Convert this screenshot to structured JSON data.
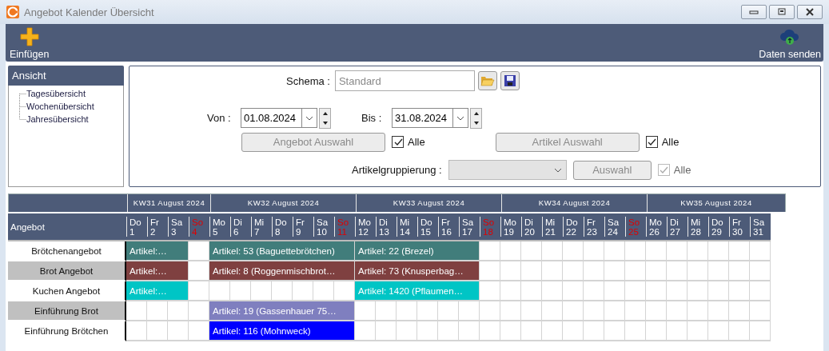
{
  "window": {
    "title": "Angebot Kalender Übersicht"
  },
  "toolbar": {
    "insert_button": "Einfügen",
    "send_button": "Daten senden"
  },
  "view_panel": {
    "title": "Ansicht",
    "items": [
      {
        "label": "Tagesübersicht"
      },
      {
        "label": "Wochenübersicht"
      },
      {
        "label": "Jahresübersicht"
      }
    ]
  },
  "filters": {
    "schema_label": "Schema :",
    "schema": {
      "placeholder": "Standard"
    },
    "from_label": "Von :",
    "from_date": "01.08.2024",
    "to_label": "Bis :",
    "to_date": "31.08.2024",
    "selections": [
      {
        "button": "Angebot Auswahl",
        "button_disabled": true,
        "checkbox_label": "Alle",
        "checked": true,
        "disabled": false
      },
      {
        "button": "Artikel Auswahl",
        "button_disabled": true,
        "checkbox_label": "Alle",
        "checked": true,
        "disabled": false
      }
    ],
    "grouping_label": "Artikelgruppierung :",
    "grouping_disabled": true,
    "grouping_selection": {
      "button": "Auswahl",
      "button_disabled": true,
      "checkbox_label": "Alle",
      "checked": true,
      "disabled": true
    }
  },
  "calendar": {
    "row_header": "Angebot",
    "weeks": [
      {
        "label": "KW31 August 2024",
        "days": [
          {
            "weekday": "Do",
            "day": "1",
            "sunday": false
          },
          {
            "weekday": "Fr",
            "day": "2",
            "sunday": false
          },
          {
            "weekday": "Sa",
            "day": "3",
            "sunday": false
          },
          {
            "weekday": "So",
            "day": "4",
            "sunday": true
          }
        ]
      },
      {
        "label": "KW32 August 2024",
        "days": [
          {
            "weekday": "Mo",
            "day": "5",
            "sunday": false
          },
          {
            "weekday": "Di",
            "day": "6",
            "sunday": false
          },
          {
            "weekday": "Mi",
            "day": "7",
            "sunday": false
          },
          {
            "weekday": "Do",
            "day": "8",
            "sunday": false
          },
          {
            "weekday": "Fr",
            "day": "9",
            "sunday": false
          },
          {
            "weekday": "Sa",
            "day": "10",
            "sunday": false
          },
          {
            "weekday": "So",
            "day": "11",
            "sunday": true
          }
        ]
      },
      {
        "label": "KW33 August 2024",
        "days": [
          {
            "weekday": "Mo",
            "day": "12",
            "sunday": false
          },
          {
            "weekday": "Di",
            "day": "13",
            "sunday": false
          },
          {
            "weekday": "Mi",
            "day": "14",
            "sunday": false
          },
          {
            "weekday": "Do",
            "day": "15",
            "sunday": false
          },
          {
            "weekday": "Fr",
            "day": "16",
            "sunday": false
          },
          {
            "weekday": "Sa",
            "day": "17",
            "sunday": false
          },
          {
            "weekday": "So",
            "day": "18",
            "sunday": true
          }
        ]
      },
      {
        "label": "KW34 August 2024",
        "days": [
          {
            "weekday": "Mo",
            "day": "19",
            "sunday": false
          },
          {
            "weekday": "Di",
            "day": "20",
            "sunday": false
          },
          {
            "weekday": "Mi",
            "day": "21",
            "sunday": false
          },
          {
            "weekday": "Do",
            "day": "22",
            "sunday": false
          },
          {
            "weekday": "Fr",
            "day": "23",
            "sunday": false
          },
          {
            "weekday": "Sa",
            "day": "24",
            "sunday": false
          },
          {
            "weekday": "So",
            "day": "25",
            "sunday": true
          }
        ]
      },
      {
        "label": "KW35 August 2024",
        "days": [
          {
            "weekday": "Mo",
            "day": "26",
            "sunday": false
          },
          {
            "weekday": "Di",
            "day": "27",
            "sunday": false
          },
          {
            "weekday": "Mi",
            "day": "28",
            "sunday": false
          },
          {
            "weekday": "Do",
            "day": "29",
            "sunday": false
          },
          {
            "weekday": "Fr",
            "day": "30",
            "sunday": false
          },
          {
            "weekday": "Sa",
            "day": "31",
            "sunday": false
          }
        ]
      }
    ],
    "rows": [
      {
        "label": "Brötchenangebot",
        "cells": [
          {
            "kind": "bar",
            "text": "Artikel:…",
            "color": "#417d7b"
          },
          {
            "kind": "continued"
          },
          {
            "kind": "continued"
          },
          {
            "kind": "empty"
          },
          {
            "kind": "bar",
            "text": "Artikel: 53 (Baguettebrötchen)",
            "color": "#417d7b"
          },
          {
            "kind": "continued"
          },
          {
            "kind": "continued"
          },
          {
            "kind": "continued"
          },
          {
            "kind": "continued"
          },
          {
            "kind": "continued"
          },
          {
            "kind": "continued"
          },
          {
            "kind": "bar",
            "text": "Artikel: 22 (Brezel)",
            "color": "#417d7b"
          },
          {
            "kind": "continued"
          },
          {
            "kind": "continued"
          },
          {
            "kind": "continued"
          },
          {
            "kind": "continued"
          },
          {
            "kind": "continued"
          },
          {
            "kind": "empty"
          },
          {
            "kind": "empty"
          },
          {
            "kind": "empty"
          },
          {
            "kind": "empty"
          },
          {
            "kind": "empty"
          },
          {
            "kind": "empty"
          },
          {
            "kind": "empty"
          },
          {
            "kind": "empty"
          },
          {
            "kind": "empty"
          },
          {
            "kind": "empty"
          },
          {
            "kind": "empty"
          },
          {
            "kind": "empty"
          },
          {
            "kind": "empty"
          },
          {
            "kind": "empty"
          }
        ]
      },
      {
        "label": "Brot Angebot",
        "cells": [
          {
            "kind": "bar",
            "text": "Artikel:…",
            "color": "#7f4040"
          },
          {
            "kind": "continued"
          },
          {
            "kind": "continued"
          },
          {
            "kind": "empty"
          },
          {
            "kind": "bar",
            "text": "Artikel: 8 (Roggenmischbrot…",
            "color": "#7f4040"
          },
          {
            "kind": "continued"
          },
          {
            "kind": "continued"
          },
          {
            "kind": "continued"
          },
          {
            "kind": "continued"
          },
          {
            "kind": "continued"
          },
          {
            "kind": "continued"
          },
          {
            "kind": "bar",
            "text": "Artikel: 73 (Knusperbag…",
            "color": "#7f4040"
          },
          {
            "kind": "continued"
          },
          {
            "kind": "continued"
          },
          {
            "kind": "continued"
          },
          {
            "kind": "continued"
          },
          {
            "kind": "continued"
          },
          {
            "kind": "empty"
          },
          {
            "kind": "empty"
          },
          {
            "kind": "empty"
          },
          {
            "kind": "empty"
          },
          {
            "kind": "empty"
          },
          {
            "kind": "empty"
          },
          {
            "kind": "empty"
          },
          {
            "kind": "empty"
          },
          {
            "kind": "empty"
          },
          {
            "kind": "empty"
          },
          {
            "kind": "empty"
          },
          {
            "kind": "empty"
          },
          {
            "kind": "empty"
          },
          {
            "kind": "empty"
          }
        ]
      },
      {
        "label": "Kuchen Angebot",
        "cells": [
          {
            "kind": "bar",
            "text": "Artikel:…",
            "color": "#00c5c5"
          },
          {
            "kind": "continued"
          },
          {
            "kind": "continued"
          },
          {
            "kind": "empty"
          },
          {
            "kind": "empty"
          },
          {
            "kind": "empty"
          },
          {
            "kind": "empty"
          },
          {
            "kind": "empty"
          },
          {
            "kind": "empty"
          },
          {
            "kind": "empty"
          },
          {
            "kind": "empty"
          },
          {
            "kind": "bar",
            "text": "Artikel: 1420 (Pflaumen…",
            "color": "#00c5c5"
          },
          {
            "kind": "continued"
          },
          {
            "kind": "continued"
          },
          {
            "kind": "continued"
          },
          {
            "kind": "continued"
          },
          {
            "kind": "continued"
          },
          {
            "kind": "empty"
          },
          {
            "kind": "empty"
          },
          {
            "kind": "empty"
          },
          {
            "kind": "empty"
          },
          {
            "kind": "empty"
          },
          {
            "kind": "empty"
          },
          {
            "kind": "empty"
          },
          {
            "kind": "empty"
          },
          {
            "kind": "empty"
          },
          {
            "kind": "empty"
          },
          {
            "kind": "empty"
          },
          {
            "kind": "empty"
          },
          {
            "kind": "empty"
          },
          {
            "kind": "empty"
          }
        ]
      },
      {
        "label": "Einführung Brot",
        "cells": [
          {
            "kind": "empty"
          },
          {
            "kind": "empty"
          },
          {
            "kind": "empty"
          },
          {
            "kind": "empty"
          },
          {
            "kind": "bar",
            "text": "Artikel: 19 (Gassenhauer 75…",
            "color": "#7f7fbf"
          },
          {
            "kind": "continued"
          },
          {
            "kind": "continued"
          },
          {
            "kind": "continued"
          },
          {
            "kind": "continued"
          },
          {
            "kind": "continued"
          },
          {
            "kind": "continued"
          },
          {
            "kind": "empty"
          },
          {
            "kind": "empty"
          },
          {
            "kind": "empty"
          },
          {
            "kind": "empty"
          },
          {
            "kind": "empty"
          },
          {
            "kind": "empty"
          },
          {
            "kind": "empty"
          },
          {
            "kind": "empty"
          },
          {
            "kind": "empty"
          },
          {
            "kind": "empty"
          },
          {
            "kind": "empty"
          },
          {
            "kind": "empty"
          },
          {
            "kind": "empty"
          },
          {
            "kind": "empty"
          },
          {
            "kind": "empty"
          },
          {
            "kind": "empty"
          },
          {
            "kind": "empty"
          },
          {
            "kind": "empty"
          },
          {
            "kind": "empty"
          },
          {
            "kind": "empty"
          }
        ]
      },
      {
        "label": "Einführung Brötchen",
        "cells": [
          {
            "kind": "empty"
          },
          {
            "kind": "empty"
          },
          {
            "kind": "empty"
          },
          {
            "kind": "empty"
          },
          {
            "kind": "bar",
            "text": "Artikel: 116 (Mohnweck)",
            "color": "#0000ff"
          },
          {
            "kind": "continued"
          },
          {
            "kind": "continued"
          },
          {
            "kind": "continued"
          },
          {
            "kind": "continued"
          },
          {
            "kind": "continued"
          },
          {
            "kind": "continued"
          },
          {
            "kind": "empty"
          },
          {
            "kind": "empty"
          },
          {
            "kind": "empty"
          },
          {
            "kind": "empty"
          },
          {
            "kind": "empty"
          },
          {
            "kind": "empty"
          },
          {
            "kind": "empty"
          },
          {
            "kind": "empty"
          },
          {
            "kind": "empty"
          },
          {
            "kind": "empty"
          },
          {
            "kind": "empty"
          },
          {
            "kind": "empty"
          },
          {
            "kind": "empty"
          },
          {
            "kind": "empty"
          },
          {
            "kind": "empty"
          },
          {
            "kind": "empty"
          },
          {
            "kind": "empty"
          },
          {
            "kind": "empty"
          },
          {
            "kind": "empty"
          },
          {
            "kind": "empty"
          }
        ]
      }
    ]
  }
}
